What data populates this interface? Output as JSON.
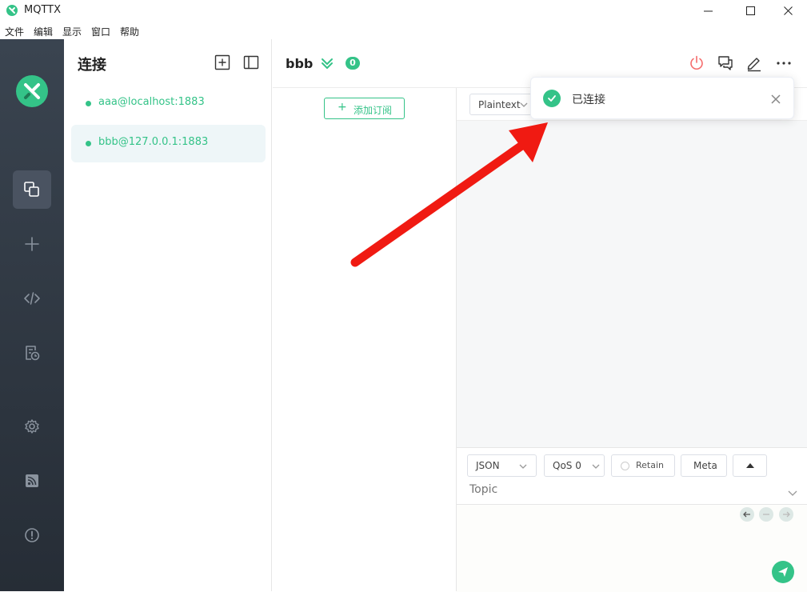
{
  "window": {
    "title": "MQTTX"
  },
  "menu": [
    "文件",
    "编辑",
    "显示",
    "窗口",
    "帮助"
  ],
  "connections": {
    "title": "连接",
    "items": [
      {
        "label": "aaa@localhost:1883",
        "status": "connected"
      },
      {
        "label": "bbb@127.0.0.1:1883",
        "status": "connected",
        "selected": true
      }
    ]
  },
  "header": {
    "connection_name": "bbb",
    "badge_count": "0"
  },
  "subscriptions": {
    "add_label": "添加订阅"
  },
  "messages": {
    "payload_format": "Plaintext"
  },
  "publish": {
    "format": "JSON",
    "qos": "QoS 0",
    "retain_label": "Retain",
    "meta_label": "Meta",
    "topic_placeholder": "Topic"
  },
  "notification": {
    "text": "已连接"
  },
  "colors": {
    "accent": "#34c388",
    "rail": "#2e3640",
    "danger": "#f56c6c"
  }
}
